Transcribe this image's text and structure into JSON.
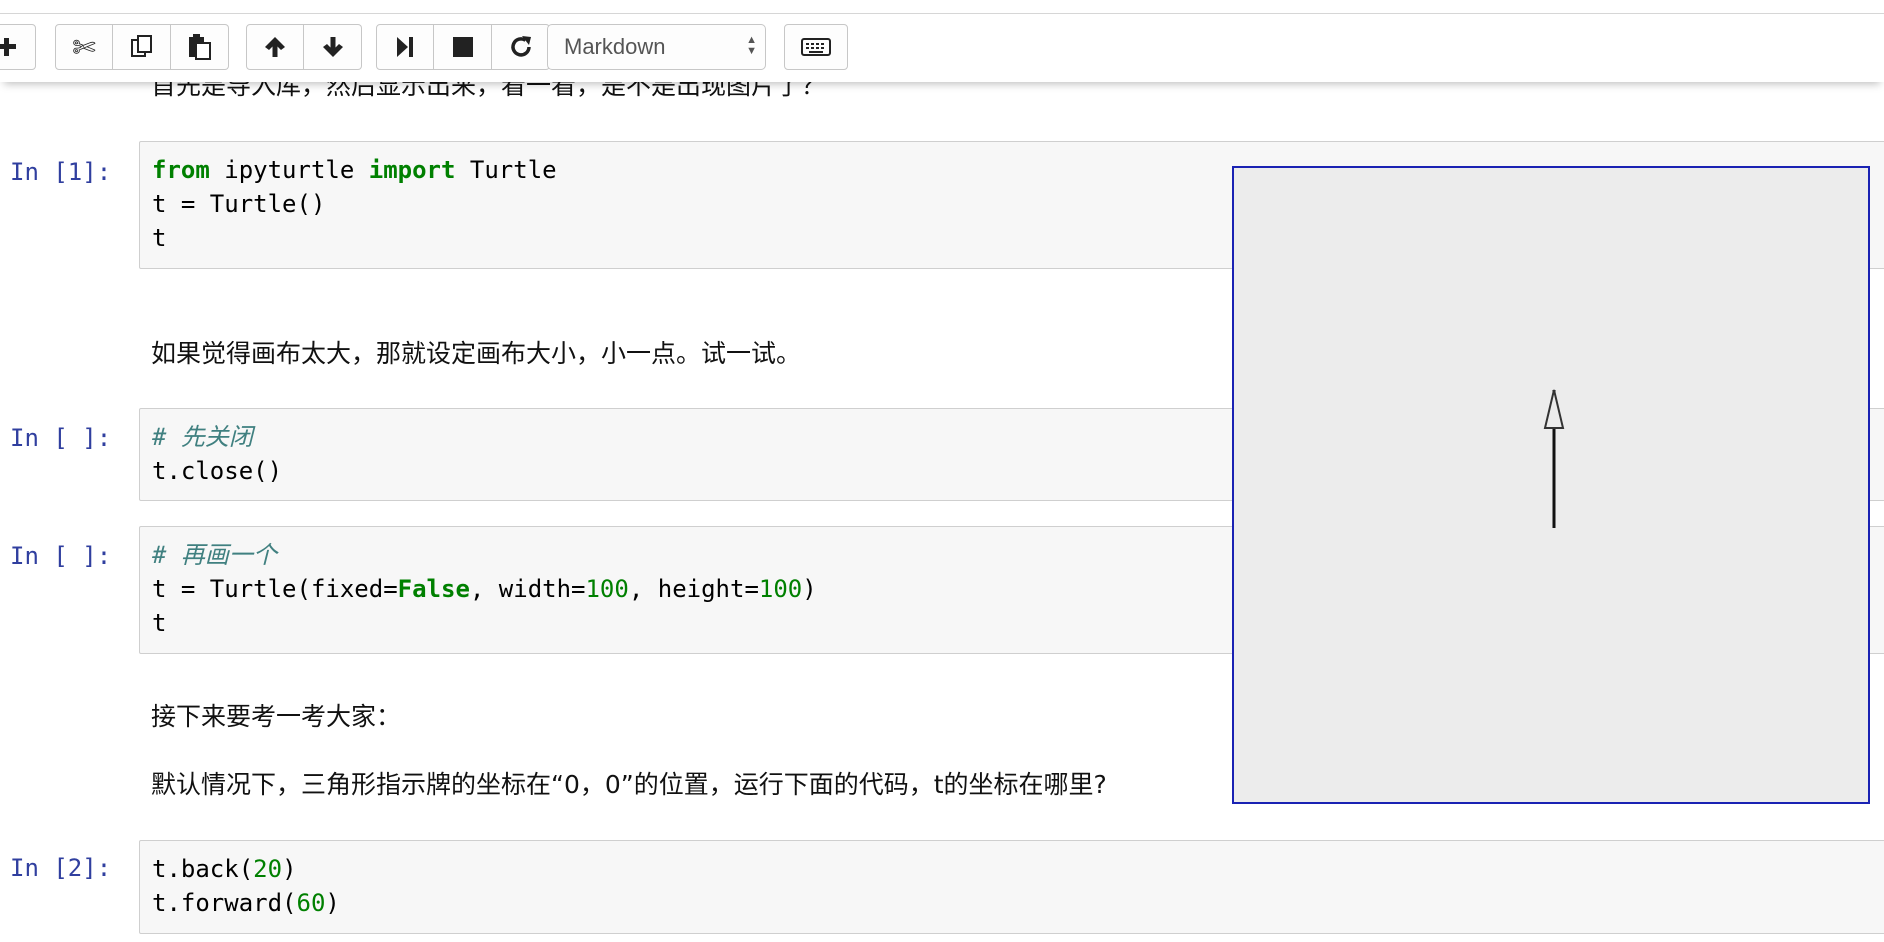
{
  "toolbar": {
    "buttons": [
      {
        "name": "add-cell-button",
        "icon": "plus-icon"
      },
      {
        "name": "cut-button",
        "icon": "scissors-icon"
      },
      {
        "name": "copy-button",
        "icon": "copy-icon"
      },
      {
        "name": "paste-button",
        "icon": "paste-icon"
      },
      {
        "name": "move-up-button",
        "icon": "arrow-up-icon"
      },
      {
        "name": "move-down-button",
        "icon": "arrow-down-icon"
      },
      {
        "name": "run-button",
        "icon": "step-forward-icon"
      },
      {
        "name": "interrupt-button",
        "icon": "stop-icon"
      },
      {
        "name": "restart-button",
        "icon": "refresh-icon"
      }
    ],
    "cell_type": "Markdown",
    "keyboard_icon": "keyboard-icon"
  },
  "cells": {
    "md0": "首先是导入库，然后显示出来，看一看，是不是出现图片了？",
    "c1": {
      "prompt": "In [1]:",
      "lines": [
        [
          {
            "t": "from",
            "c": "kw"
          },
          {
            "t": " ipyturtle ",
            "c": ""
          },
          {
            "t": "import",
            "c": "kw"
          },
          {
            "t": " Turtle",
            "c": ""
          }
        ],
        [
          {
            "t": "t = Turtle()",
            "c": ""
          }
        ],
        [
          {
            "t": "t",
            "c": ""
          }
        ]
      ]
    },
    "md1": "如果觉得画布太大，那就设定画布大小，小一点。试一试。",
    "c2": {
      "prompt": "In [ ]:",
      "lines": [
        [
          {
            "t": "# 先关闭",
            "c": "cm"
          }
        ],
        [
          {
            "t": "t.close()",
            "c": ""
          }
        ]
      ]
    },
    "c3": {
      "prompt": "In [ ]:",
      "lines": [
        [
          {
            "t": "# 再画一个",
            "c": "cm"
          }
        ],
        [
          {
            "t": "t = Turtle(fixed=",
            "c": ""
          },
          {
            "t": "False",
            "c": "kw"
          },
          {
            "t": ", width=",
            "c": ""
          },
          {
            "t": "100",
            "c": "num"
          },
          {
            "t": ", height=",
            "c": ""
          },
          {
            "t": "100",
            "c": "num"
          },
          {
            "t": ")",
            "c": ""
          }
        ],
        [
          {
            "t": "t",
            "c": ""
          }
        ]
      ]
    },
    "md2": "接下来要考一考大家：",
    "md3": "默认情况下，三角形指示牌的坐标在“0，0”的位置，运行下面的代码，t的坐标在哪里?",
    "c4": {
      "prompt": "In [2]:",
      "lines": [
        [
          {
            "t": "t.back(",
            "c": ""
          },
          {
            "t": "20",
            "c": "num"
          },
          {
            "t": ")",
            "c": ""
          }
        ],
        [
          {
            "t": "t.forward(",
            "c": ""
          },
          {
            "t": "60",
            "c": "num"
          },
          {
            "t": ")",
            "c": ""
          }
        ]
      ]
    }
  },
  "turtle": {
    "colors": {
      "border": "#1a22b3",
      "background": "#ececec"
    }
  }
}
